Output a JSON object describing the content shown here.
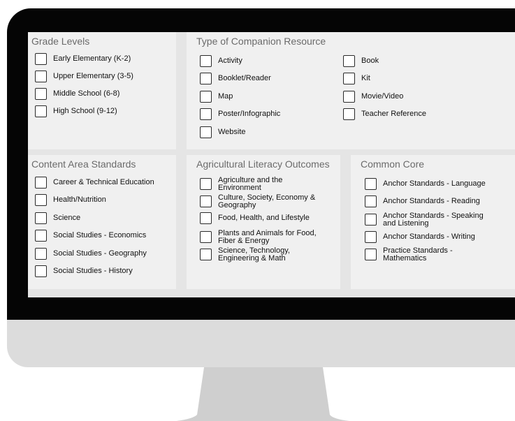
{
  "panels": {
    "grade_levels": {
      "title": "Grade Levels",
      "options": [
        "Early Elementary (K-2)",
        "Upper Elementary (3-5)",
        "Middle School (6-8)",
        "High School (9-12)"
      ]
    },
    "companion_resource": {
      "title": "Type of Companion Resource",
      "col1": [
        "Activity",
        "Booklet/Reader",
        "Map",
        "Poster/Infographic",
        "Website"
      ],
      "col2": [
        "Book",
        "Kit",
        "Movie/Video",
        "Teacher Reference"
      ]
    },
    "content_area": {
      "title": "Content Area Standards",
      "options": [
        "Career & Technical Education",
        "Health/Nutrition",
        "Science",
        "Social Studies - Economics",
        "Social Studies - Geography",
        "Social Studies - History"
      ]
    },
    "ag_literacy": {
      "title": "Agricultural Literacy Outcomes",
      "options": [
        "Agriculture and the Environment",
        "Culture, Society, Economy & Geography",
        "Food, Health, and Lifestyle",
        "Plants and Animals for Food, Fiber & Energy",
        "Science, Technology, Engineering & Math"
      ]
    },
    "common_core": {
      "title": "Common Core",
      "options": [
        "Anchor Standards - Language",
        "Anchor Standards - Reading",
        "Anchor Standards - Speaking and Listening",
        "Anchor Standards - Writing",
        "Practice Standards - Mathematics"
      ]
    }
  }
}
